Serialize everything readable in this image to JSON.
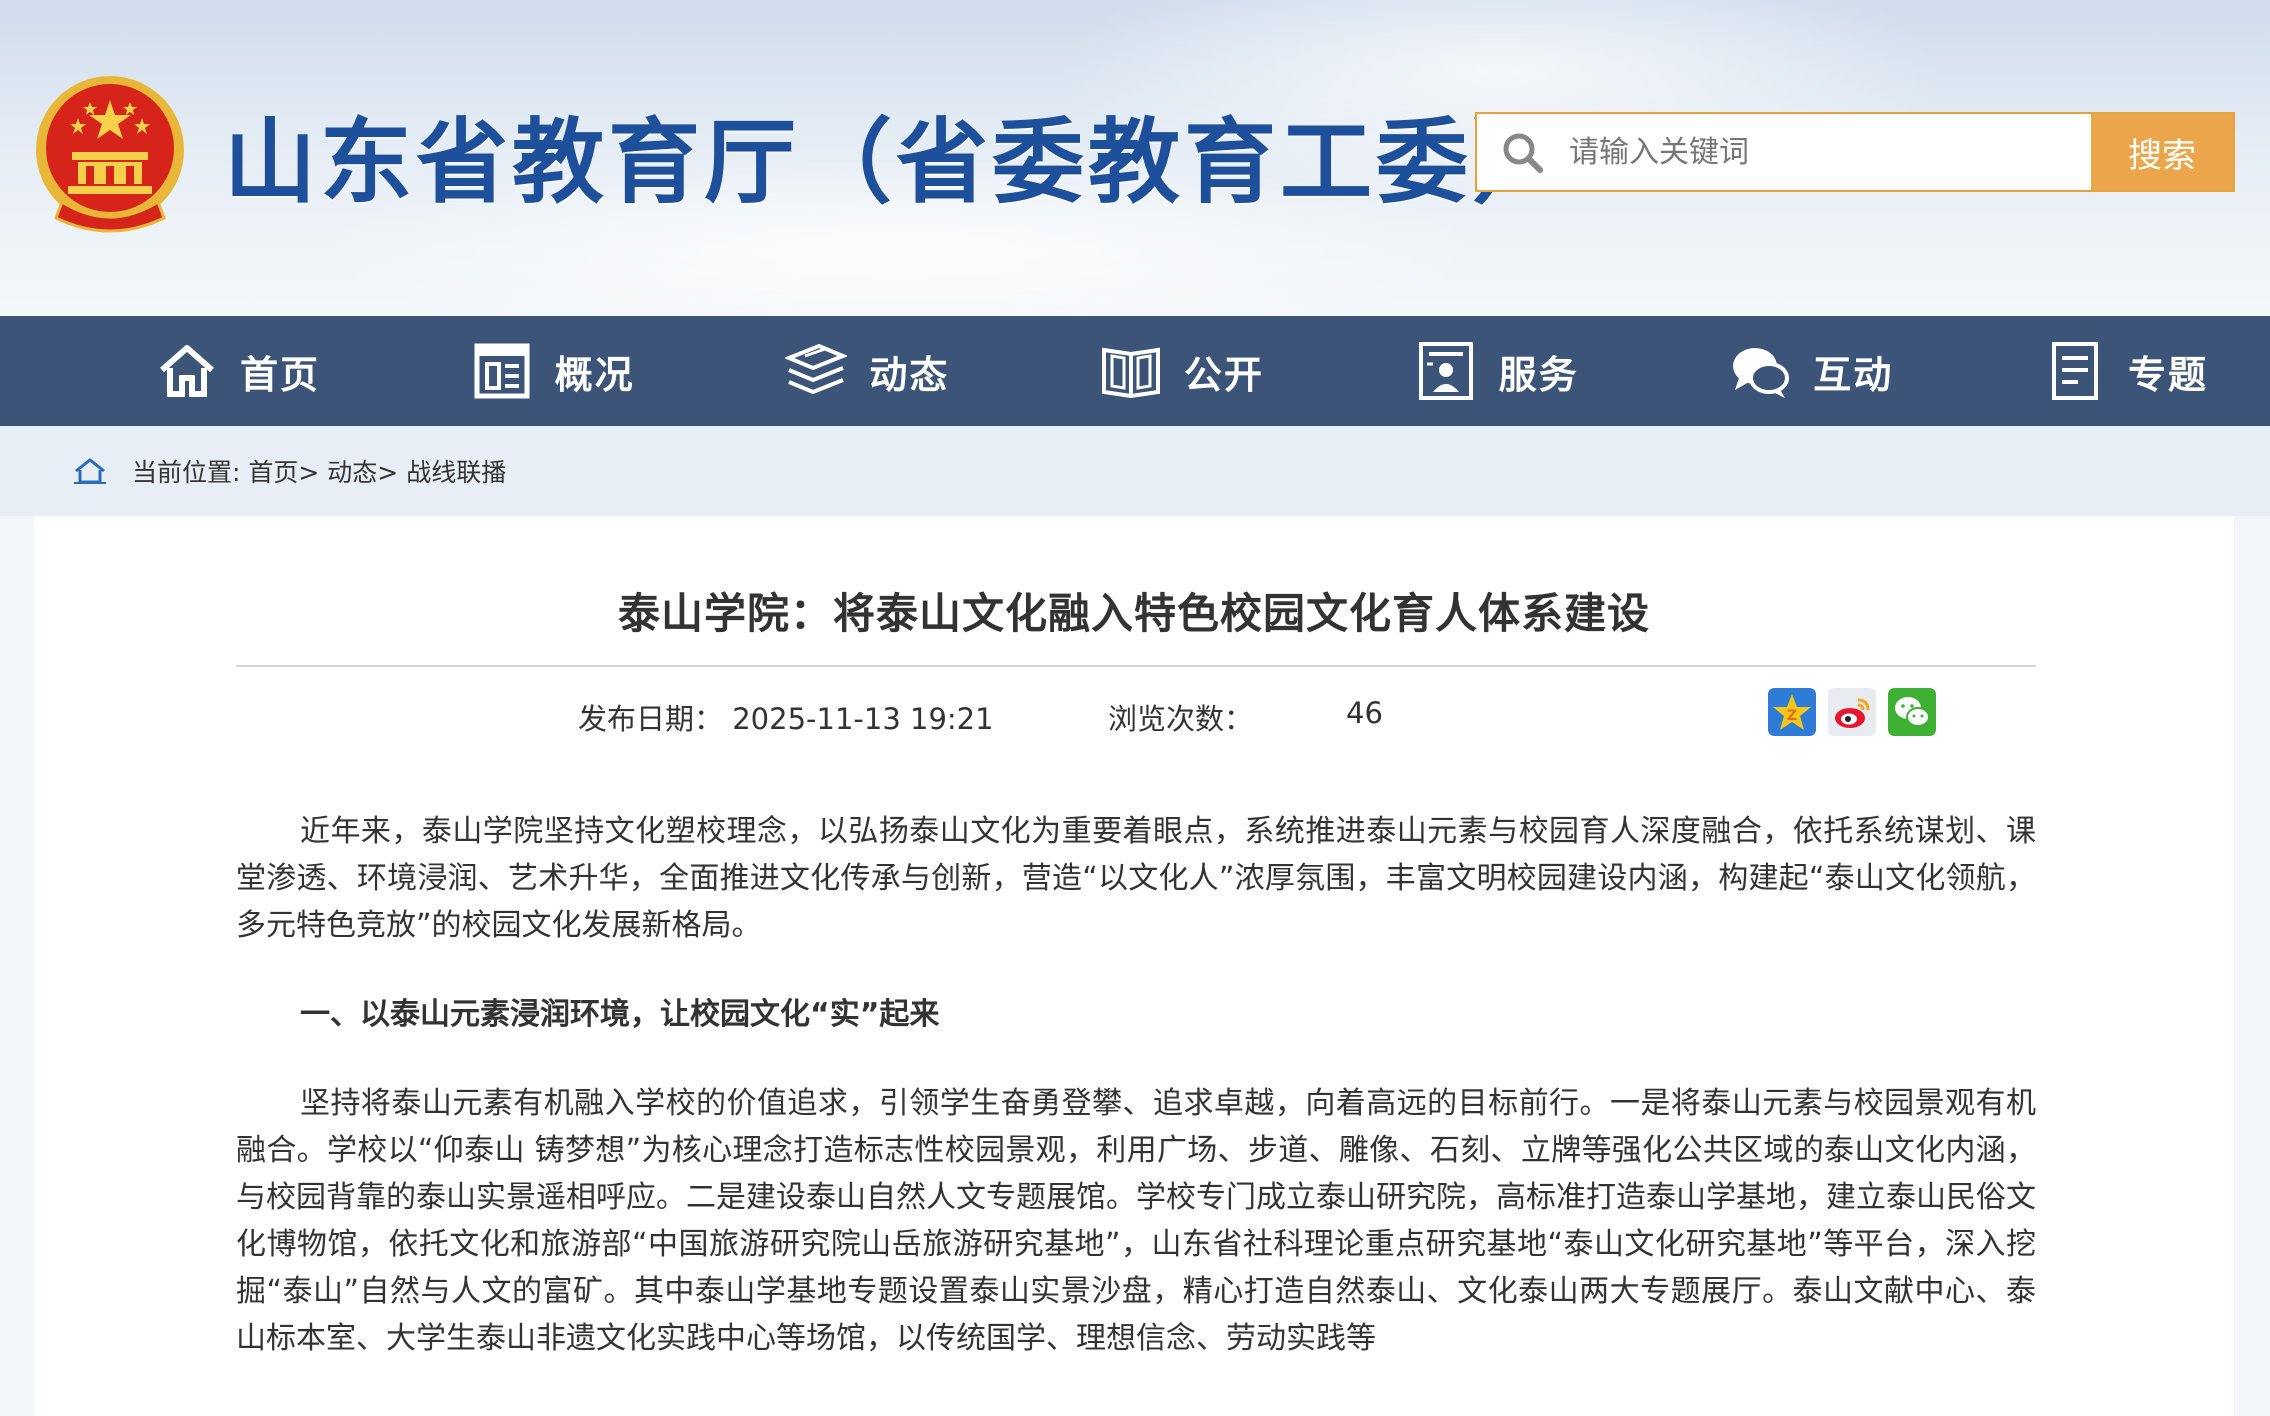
{
  "header": {
    "site_title": "山东省教育厅（省委教育工委）",
    "search": {
      "placeholder": "请输入关键词",
      "button": "搜索"
    }
  },
  "nav": {
    "items": [
      {
        "label": "首页",
        "icon": "home-icon"
      },
      {
        "label": "概况",
        "icon": "overview-icon"
      },
      {
        "label": "动态",
        "icon": "news-stack-icon"
      },
      {
        "label": "公开",
        "icon": "open-book-icon"
      },
      {
        "label": "服务",
        "icon": "service-icon"
      },
      {
        "label": "互动",
        "icon": "chat-bubble-icon"
      },
      {
        "label": "专题",
        "icon": "document-icon"
      }
    ]
  },
  "breadcrumb": {
    "prefix": "当前位置:",
    "items": [
      "首页>",
      "动态>",
      "战线联播"
    ]
  },
  "article": {
    "title": "泰山学院：将泰山文化融入特色校园文化育人体系建设",
    "publish_label": "发布日期：",
    "publish_date": "2025-11-13 19:21",
    "views_label": "浏览次数：",
    "views": "46",
    "share": [
      "qzone-icon",
      "weibo-icon",
      "wechat-icon"
    ],
    "paragraphs": [
      "近年来，泰山学院坚持文化塑校理念，以弘扬泰山文化为重要着眼点，系统推进泰山元素与校园育人深度融合，依托系统谋划、课堂渗透、环境浸润、艺术升华，全面推进文化传承与创新，营造“以文化人”浓厚氛围，丰富文明校园建设内涵，构建起“泰山文化领航，多元特色竞放”的校园文化发展新格局。",
      "一、以泰山元素浸润环境，让校园文化“实”起来",
      "坚持将泰山元素有机融入学校的价值追求，引领学生奋勇登攀、追求卓越，向着高远的目标前行。一是将泰山元素与校园景观有机融合。学校以“仰泰山 铸梦想”为核心理念打造标志性校园景观，利用广场、步道、雕像、石刻、立牌等强化公共区域的泰山文化内涵，与校园背靠的泰山实景遥相呼应。二是建设泰山自然人文专题展馆。学校专门成立泰山研究院，高标准打造泰山学基地，建立泰山民俗文化博物馆，依托文化和旅游部“中国旅游研究院山岳旅游研究基地”，山东省社科理论重点研究基地“泰山文化研究基地”等平台，深入挖掘“泰山”自然与人文的富矿。其中泰山学基地专题设置泰山实景沙盘，精心打造自然泰山、文化泰山两大专题展厅。泰山文献中心、泰山标本室、大学生泰山非遗文化实践中心等场馆，以传统国学、理想信念、劳动实践等"
    ]
  },
  "colors": {
    "nav_bg": "#3b5478",
    "title_blue": "#1d4f9a",
    "search_accent": "#eba64b"
  }
}
